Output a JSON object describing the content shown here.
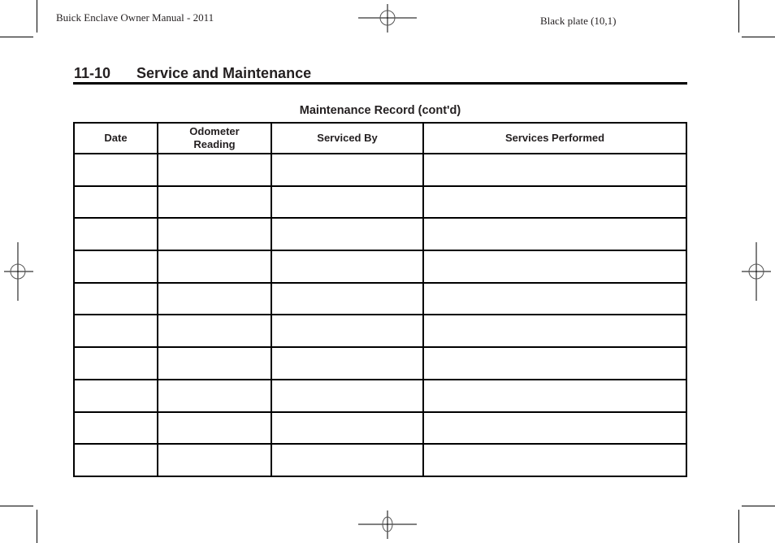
{
  "header": {
    "manual_title": "Buick Enclave Owner Manual - 2011",
    "plate": "Black plate (10,1)"
  },
  "section": {
    "number": "11-10",
    "title": "Service and Maintenance"
  },
  "table": {
    "caption": "Maintenance Record (cont'd)",
    "columns": [
      "Date",
      "Odometer Reading",
      "Serviced By",
      "Services Performed"
    ],
    "rows": [
      [
        "",
        "",
        "",
        ""
      ],
      [
        "",
        "",
        "",
        ""
      ],
      [
        "",
        "",
        "",
        ""
      ],
      [
        "",
        "",
        "",
        ""
      ],
      [
        "",
        "",
        "",
        ""
      ],
      [
        "",
        "",
        "",
        ""
      ],
      [
        "",
        "",
        "",
        ""
      ],
      [
        "",
        "",
        "",
        ""
      ],
      [
        "",
        "",
        "",
        ""
      ],
      [
        "",
        "",
        "",
        ""
      ]
    ]
  },
  "marks": {
    "crop_mark_icon": "crop-mark",
    "registration_icon": "registration-crosshair"
  }
}
